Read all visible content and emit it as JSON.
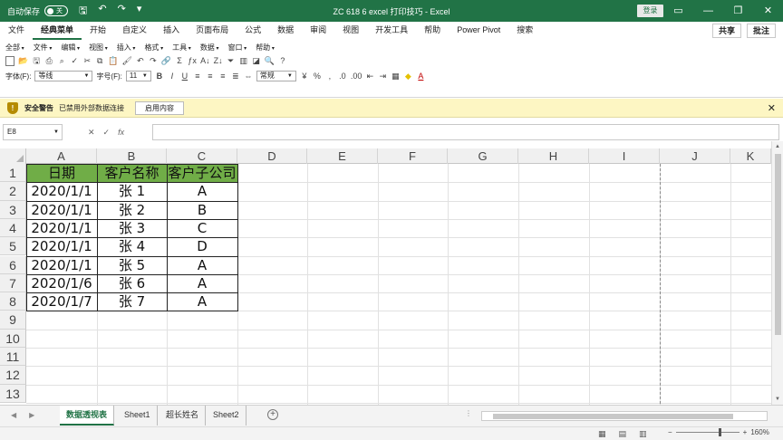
{
  "titlebar": {
    "autosave_label": "自动保存",
    "autosave_state": "关",
    "doc_title": "ZC 618 6 excel 打印技巧  -  Excel",
    "login_label": "登录",
    "icons": [
      "save-icon",
      "undo-icon",
      "redo-icon",
      "customize-icon"
    ]
  },
  "menu_tabs": [
    "文件",
    "经典菜单",
    "开始",
    "自定义",
    "插入",
    "页面布局",
    "公式",
    "数据",
    "审阅",
    "视图",
    "开发工具",
    "帮助",
    "Power Pivot",
    "搜索"
  ],
  "menu_right": {
    "share": "共享",
    "comment": "批注"
  },
  "ribbon": {
    "row1": [
      "全部",
      "文件",
      "编辑",
      "视图",
      "插入",
      "格式",
      "工具",
      "数据",
      "窗口",
      "帮助"
    ],
    "font_label": "字体(F):",
    "font_value": "等线",
    "size_label": "字号(F):",
    "size_value": "11",
    "number_format": "常规"
  },
  "security_bar": {
    "title": "安全警告",
    "message": "已禁用外部数据连接",
    "button": "启用内容"
  },
  "formula_bar": {
    "name_box": "E8",
    "formula": ""
  },
  "grid": {
    "columns": [
      "A",
      "B",
      "C",
      "D",
      "E",
      "F",
      "G",
      "H",
      "I",
      "J",
      "K"
    ],
    "rows": [
      "1",
      "2",
      "3",
      "4",
      "5",
      "6",
      "7",
      "8",
      "9",
      "10",
      "11",
      "12",
      "13"
    ],
    "table": {
      "headers": [
        "日期",
        "客户名称",
        "客户子公司"
      ],
      "header_color": "#70ad47",
      "rows": [
        [
          "2020/1/1",
          "张 1",
          "A"
        ],
        [
          "2020/1/1",
          "张 2",
          "B"
        ],
        [
          "2020/1/1",
          "张 3",
          "C"
        ],
        [
          "2020/1/1",
          "张 4",
          "D"
        ],
        [
          "2020/1/1",
          "张 5",
          "A"
        ],
        [
          "2020/1/6",
          "张 6",
          "A"
        ],
        [
          "2020/1/7",
          "张 7",
          "A"
        ]
      ]
    }
  },
  "sheet_tabs": [
    "数据透视表",
    "Sheet1",
    "超长姓名",
    "Sheet2"
  ],
  "active_sheet": "数据透视表",
  "status_bar": {
    "zoom": "160%"
  },
  "colors": {
    "accent": "#217346",
    "security_bar": "#fdf6c3"
  }
}
